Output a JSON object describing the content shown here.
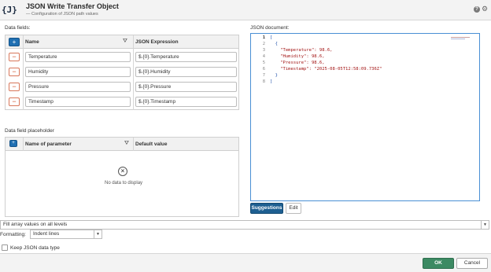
{
  "window": {
    "icon_text": "{J}",
    "title": "JSON Write Transfer Object",
    "subtitle": "— Configuration of JSON path values",
    "help_icon": "?"
  },
  "data_fields": {
    "label": "Data fields:",
    "columns": {
      "name": "Name",
      "expression": "JSON Expression"
    },
    "add_button": "+",
    "remove_button": "−",
    "rows": [
      {
        "name": "Temperature",
        "expression": "$.{0}.Temperature"
      },
      {
        "name": "Humidity",
        "expression": "$.{0}.Humidity"
      },
      {
        "name": "Pressure",
        "expression": "$.{0}.Pressure"
      },
      {
        "name": "Timestamp",
        "expression": "$.{0}.Timestamp"
      }
    ]
  },
  "placeholder": {
    "label": "Data field placeholder",
    "columns": {
      "name": "Name of parameter",
      "default": "Default value"
    },
    "add_button": "+",
    "empty_text": "No data to display"
  },
  "json_document": {
    "label": "JSON document:",
    "line_numbers": [
      "1",
      "2",
      "3",
      "4",
      "5",
      "6",
      "7",
      "8"
    ],
    "lines": [
      "[",
      "  {",
      "    \"Temperature\": 98.6,",
      "    \"Humidity\": 98.6,",
      "    \"Pressure\": 98.6,",
      "    \"Timestamp\": \"2025-08-05T12:58:09.736Z\"",
      "  }",
      "]"
    ],
    "suggestions_button": "Suggestions",
    "edit_button": "Edit"
  },
  "array_select": {
    "value": "Fill array values on all levels"
  },
  "formatting": {
    "label": "Formatting:",
    "value": "Indent lines"
  },
  "keep_type": {
    "label": "Keep JSON data type",
    "checked": false
  },
  "footer": {
    "ok": "OK",
    "cancel": "Cancel"
  },
  "colors": {
    "accent_blue": "#1f6fb2",
    "ok_green": "#3c8a63",
    "remove_red": "#d0532e"
  }
}
